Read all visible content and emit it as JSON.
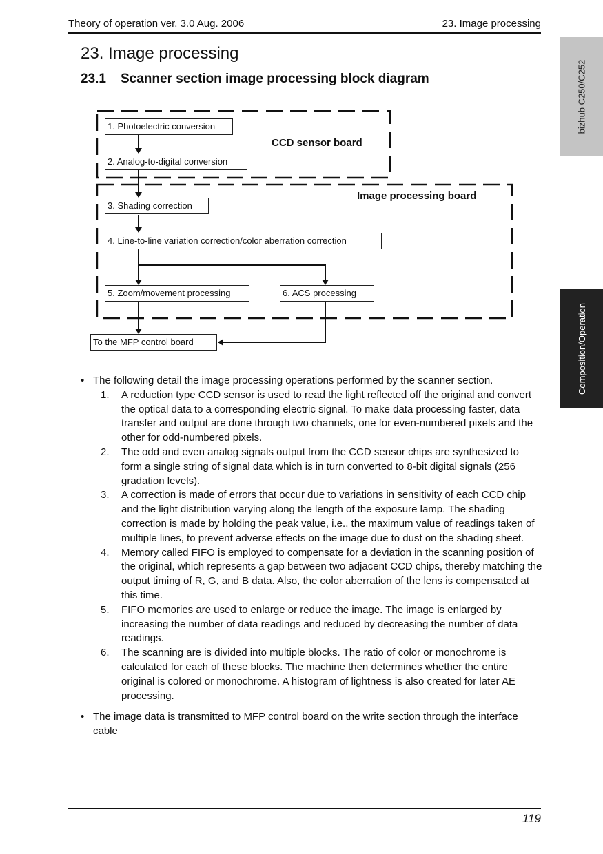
{
  "header": {
    "left": "Theory of operation ver. 3.0 Aug. 2006",
    "right": "23. Image processing"
  },
  "side_tabs": {
    "model": "bizhub C250/C252",
    "section": "Composition/Operation"
  },
  "section": {
    "title": "23.  Image processing",
    "subsection_number": "23.1",
    "subsection_title": "Scanner section image processing block diagram"
  },
  "diagram": {
    "group_labels": {
      "ccd": "CCD sensor board",
      "ipb": "Image processing board"
    },
    "blocks": [
      "1. Photoelectric conversion",
      "2. Analog-to-digital conversion",
      "3. Shading correction",
      "4. Line-to-line variation correction/color aberration correction",
      "5. Zoom/movement processing",
      "6. ACS processing"
    ],
    "output": "To the MFP control board"
  },
  "body": {
    "intro_bullet": "The following detail the image processing operations performed by the scanner section.",
    "bullet_symbol": "•",
    "steps": [
      {
        "n": "1.",
        "text": "A reduction type CCD sensor is used to read the light reflected off the original and convert the optical data to a corresponding electric signal. To make data processing faster, data transfer and output are done through two channels, one for even-numbered pixels and the other for odd-numbered pixels."
      },
      {
        "n": "2.",
        "text": "The odd and even analog signals output from the CCD sensor chips are synthesized to form a single string of signal data which is in turn converted to 8-bit digital signals (256 gradation levels)."
      },
      {
        "n": "3.",
        "text": "A correction is made of errors that occur due to variations in sensitivity of each CCD chip and the light distribution varying along the length of the exposure lamp. The shading correction is made by holding the peak value, i.e., the maximum value of readings taken of multiple lines, to prevent adverse effects on the image due to dust on the shading sheet."
      },
      {
        "n": "4.",
        "text": "Memory called FIFO is employed to compensate for a deviation in the scanning position of the original, which represents a gap between two adjacent CCD chips, thereby matching the output timing of R, G, and B data. Also, the color aberration of the lens is compensated at this time."
      },
      {
        "n": "5.",
        "text": "FIFO memories are used to enlarge or reduce the image. The image is enlarged by increasing the number of data readings and reduced by decreasing the number of data readings."
      },
      {
        "n": "6.",
        "text": "The scanning are is divided into multiple blocks. The ratio of color or monochrome is calculated for each of these blocks. The machine then determines whether the entire original is colored or monochrome. A histogram of lightness is also created for later AE processing."
      }
    ],
    "final_bullet": "The image data is transmitted to MFP control board on the write section through the interface cable"
  },
  "footer": {
    "page_number": "119"
  }
}
